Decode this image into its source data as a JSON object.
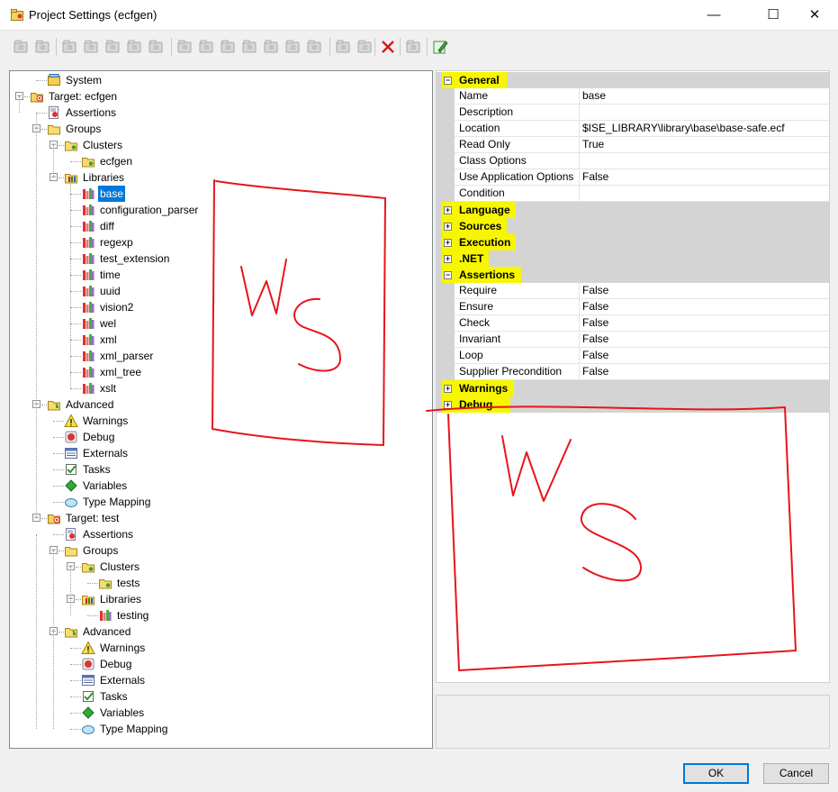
{
  "window": {
    "title": "Project Settings (ecfgen)",
    "controls": {
      "minimize": "—",
      "maximize": "☐",
      "close": "✕"
    }
  },
  "toolbar": {
    "buttons": [
      {
        "icon": "add-target-icon"
      },
      {
        "icon": "add-library-icon"
      },
      {
        "icon": "add-cluster-icon"
      },
      {
        "icon": "add-override-icon"
      },
      {
        "icon": "add-precompile-icon"
      },
      {
        "icon": "add-assembly-icon"
      },
      {
        "icon": "add-test-cluster-icon"
      },
      {
        "icon": "add-external-include-icon"
      },
      {
        "icon": "add-external-object-icon"
      },
      {
        "icon": "add-external-library-icon"
      },
      {
        "icon": "add-external-resource-icon"
      },
      {
        "icon": "add-external-make-icon"
      },
      {
        "icon": "add-pre-task-icon"
      },
      {
        "icon": "add-post-task-icon"
      },
      {
        "icon": "add-variable-icon"
      },
      {
        "icon": "add-mapping-icon"
      },
      {
        "icon": "remove-icon"
      },
      {
        "icon": "edit-icon"
      },
      {
        "icon": "edit-file-icon"
      }
    ]
  },
  "tree": {
    "nodes": [
      {
        "label": "System",
        "icon": "system-icon"
      },
      {
        "label": "Target: ecfgen",
        "icon": "target-icon"
      },
      {
        "label": "Assertions",
        "icon": "assertions-icon"
      },
      {
        "label": "Groups",
        "icon": "folder-icon"
      },
      {
        "label": "Clusters",
        "icon": "cluster-folder-icon"
      },
      {
        "label": "ecfgen",
        "icon": "cluster-icon"
      },
      {
        "label": "Libraries",
        "icon": "libraries-folder-icon"
      },
      {
        "label": "base",
        "icon": "library-icon",
        "selected": true
      },
      {
        "label": "configuration_parser",
        "icon": "library-icon"
      },
      {
        "label": "diff",
        "icon": "library-icon"
      },
      {
        "label": "regexp",
        "icon": "library-icon"
      },
      {
        "label": "test_extension",
        "icon": "library-icon"
      },
      {
        "label": "time",
        "icon": "library-icon"
      },
      {
        "label": "uuid",
        "icon": "library-icon"
      },
      {
        "label": "vision2",
        "icon": "library-icon"
      },
      {
        "label": "wel",
        "icon": "library-icon"
      },
      {
        "label": "xml",
        "icon": "library-icon"
      },
      {
        "label": "xml_parser",
        "icon": "library-icon"
      },
      {
        "label": "xml_tree",
        "icon": "library-icon"
      },
      {
        "label": "xslt",
        "icon": "library-icon"
      },
      {
        "label": "Advanced",
        "icon": "advanced-icon"
      },
      {
        "label": "Warnings",
        "icon": "warning-icon"
      },
      {
        "label": "Debug",
        "icon": "debug-icon"
      },
      {
        "label": "Externals",
        "icon": "externals-icon"
      },
      {
        "label": "Tasks",
        "icon": "tasks-icon"
      },
      {
        "label": "Variables",
        "icon": "variables-icon"
      },
      {
        "label": "Type Mapping",
        "icon": "type-mapping-icon"
      },
      {
        "label": "Target: test",
        "icon": "target-icon"
      },
      {
        "label": "Assertions",
        "icon": "assertions-icon"
      },
      {
        "label": "Groups",
        "icon": "folder-icon"
      },
      {
        "label": "Clusters",
        "icon": "cluster-folder-icon"
      },
      {
        "label": "tests",
        "icon": "cluster-icon"
      },
      {
        "label": "Libraries",
        "icon": "libraries-folder-icon"
      },
      {
        "label": "testing",
        "icon": "library-icon"
      },
      {
        "label": "Advanced",
        "icon": "advanced-icon"
      },
      {
        "label": "Warnings",
        "icon": "warning-icon"
      },
      {
        "label": "Debug",
        "icon": "debug-icon"
      },
      {
        "label": "Externals",
        "icon": "externals-icon"
      },
      {
        "label": "Tasks",
        "icon": "tasks-icon"
      },
      {
        "label": "Variables",
        "icon": "variables-icon"
      },
      {
        "label": "Type Mapping",
        "icon": "type-mapping-icon"
      }
    ]
  },
  "properties": {
    "rows": [
      {
        "kind": "category",
        "name": "General",
        "toggle": "−"
      },
      {
        "kind": "property",
        "name": "Name",
        "value": "base"
      },
      {
        "kind": "property",
        "name": "Description",
        "value": ""
      },
      {
        "kind": "property",
        "name": "Location",
        "value": "$ISE_LIBRARY\\library\\base\\base-safe.ecf"
      },
      {
        "kind": "property",
        "name": "Read Only",
        "value": "True"
      },
      {
        "kind": "property",
        "name": "Class Options",
        "value": ""
      },
      {
        "kind": "property",
        "name": "Use Application Options",
        "value": "False"
      },
      {
        "kind": "property",
        "name": "Condition",
        "value": ""
      },
      {
        "kind": "category",
        "name": "Language",
        "toggle": "+"
      },
      {
        "kind": "category",
        "name": "Sources",
        "toggle": "+"
      },
      {
        "kind": "category",
        "name": "Execution",
        "toggle": "+"
      },
      {
        "kind": "category",
        "name": ".NET",
        "toggle": "+"
      },
      {
        "kind": "category",
        "name": "Assertions",
        "toggle": "−"
      },
      {
        "kind": "property",
        "name": "Require",
        "value": "False"
      },
      {
        "kind": "property",
        "name": "Ensure",
        "value": "False"
      },
      {
        "kind": "property",
        "name": "Check",
        "value": "False"
      },
      {
        "kind": "property",
        "name": "Invariant",
        "value": "False"
      },
      {
        "kind": "property",
        "name": "Loop",
        "value": "False"
      },
      {
        "kind": "property",
        "name": "Supplier Precondition",
        "value": "False"
      },
      {
        "kind": "category",
        "name": "Warnings",
        "toggle": "+"
      },
      {
        "kind": "category",
        "name": "Debug",
        "toggle": "+"
      }
    ]
  },
  "buttons": {
    "ok": "OK",
    "cancel": "Cancel"
  },
  "annotations": {
    "highlight_color": "#f6f600",
    "ink_color": "#e8141c"
  }
}
